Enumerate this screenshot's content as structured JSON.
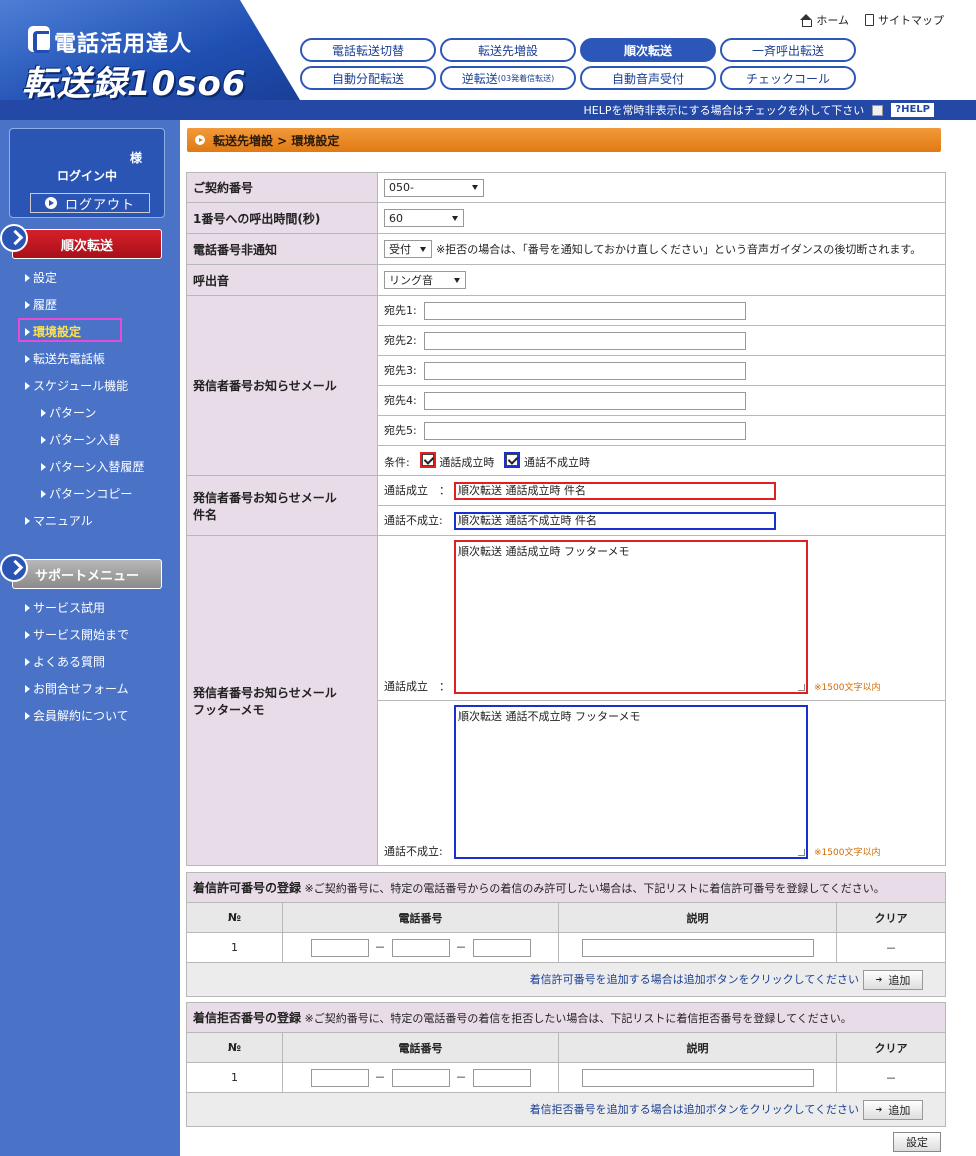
{
  "header": {
    "logo_sub": "電話活用達人",
    "logo_main": "転送録10so6",
    "home_label": "ホーム",
    "sitemap_label": "サイトマップ",
    "tabs": [
      {
        "label": "電話転送切替"
      },
      {
        "label": "転送先増設"
      },
      {
        "label": "順次転送"
      },
      {
        "label": "一斉呼出転送"
      },
      {
        "label": "自動分配転送"
      },
      {
        "label": "逆転送",
        "small": "(03発着信転送)"
      },
      {
        "label": "自動音声受付"
      },
      {
        "label": "チェックコール"
      }
    ],
    "active_tab": "順次転送",
    "help_text": "HELPを常時非表示にする場合はチェックを外して下さい",
    "help_btn": "?HELP"
  },
  "sidebar": {
    "login_sama": "様",
    "login_status": "ログイン中",
    "logout_label": "ログアウト",
    "section_main": "順次転送",
    "items": [
      "設定",
      "履歴",
      "環境設定",
      "転送先電話帳",
      "スケジュール機能"
    ],
    "sub_items": [
      "パターン",
      "パターン入替",
      "パターン入替履歴",
      "パターンコピー"
    ],
    "manual": "マニュアル",
    "section_support": "サポートメニュー",
    "support_items": [
      "サービス試用",
      "サービス開始まで",
      "よくある質問",
      "お問合せフォーム",
      "会員解約について"
    ]
  },
  "main": {
    "breadcrumb": "転送先増設 > 環境設定",
    "contract_label": "ご契約番号",
    "contract_value": "050-",
    "ring_time_label": "1番号への呼出時間(秒)",
    "ring_time_value": "60",
    "hide_number_label": "電話番号非通知",
    "hide_number_value": "受付",
    "hide_number_note": "※拒否の場合は、「番号を通知しておかけ直しください」という音声ガイダンスの後切断されます。",
    "ring_tone_label": "呼出音",
    "ring_tone_value": "リング音",
    "mail_label": "発信者番号お知らせメール",
    "recipients": [
      "宛先1:",
      "宛先2:",
      "宛先3:",
      "宛先4:",
      "宛先5:"
    ],
    "condition_label": "条件:",
    "cond_success": "通話成立時",
    "cond_fail": "通話不成立時",
    "subject_label_1": "発信者番号お知らせメール",
    "subject_label_2": "件名",
    "subj_success_label": "通話成立　：",
    "subj_success_value": "順次転送 通話成立時 件名",
    "subj_fail_label": "通話不成立:",
    "subj_fail_value": "順次転送 通話不成立時 件名",
    "footer_label_1": "発信者番号お知らせメール",
    "footer_label_2": "フッターメモ",
    "footer_success_label": "通話成立　：",
    "footer_success_value": "順次転送 通話成立時 フッターメモ",
    "footer_fail_label": "通話不成立:",
    "footer_fail_value": "順次転送 通話不成立時 フッターメモ",
    "char_limit": "※1500文字以内"
  },
  "allow": {
    "title": "着信許可番号の登録",
    "desc": "※ご契約番号に、特定の電話番号からの着信のみ許可したい場合は、下記リストに着信許可番号を登録してください。",
    "col_no": "№",
    "col_phone": "電話番号",
    "col_desc": "説明",
    "col_clear": "クリア",
    "row_no": "1",
    "row_clear": "－",
    "foot": "着信許可番号を追加する場合は追加ボタンをクリックしてください",
    "add_label": "追加"
  },
  "deny": {
    "title": "着信拒否番号の登録",
    "desc": "※ご契約番号に、特定の電話番号の着信を拒否したい場合は、下記リストに着信拒否番号を登録してください。",
    "col_no": "№",
    "col_phone": "電話番号",
    "col_desc": "説明",
    "col_clear": "クリア",
    "row_no": "1",
    "row_clear": "－",
    "foot": "着信拒否番号を追加する場合は追加ボタンをクリックしてください",
    "add_label": "追加"
  },
  "submit_label": "設定",
  "colors": {
    "brand_blue": "#2448a6",
    "sidebar": "#4a73c8",
    "label_bg": "#e9dce9",
    "breadcrumb": "#e88a24",
    "success_border": "#e02020",
    "fail_border": "#1a2fd0"
  }
}
